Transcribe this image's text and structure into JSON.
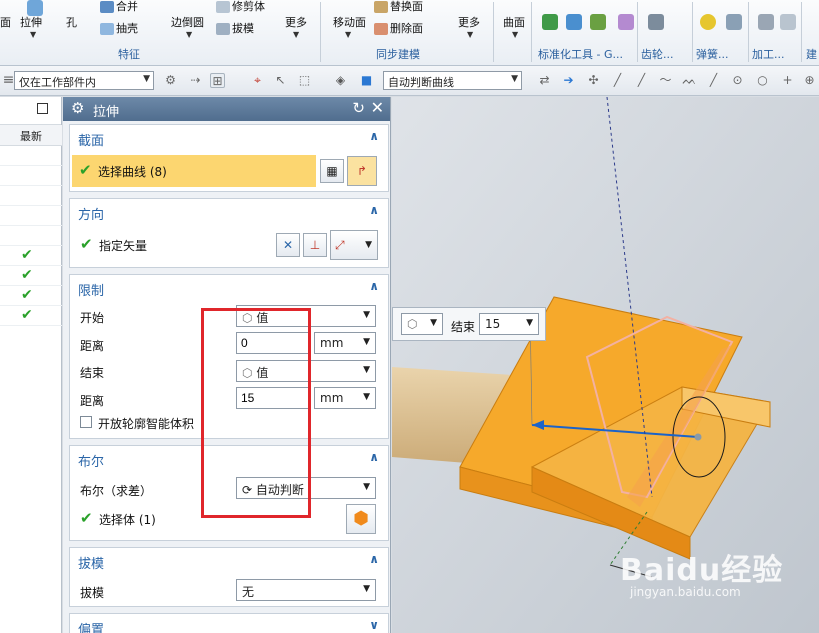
{
  "ribbon": {
    "cmds": {
      "mian": "面",
      "lashen": "拉伸",
      "kong": "孔",
      "hebing": "合并",
      "chouke": "抽壳",
      "biandaoyuan": "边倒圆",
      "xiujianti": "修剪体",
      "bamo": "拔模",
      "gengduo1": "更多",
      "yidongmian": "移动面",
      "tihuanmian": "替换面",
      "shanchumian": "删除面",
      "gengduo2": "更多",
      "qumian": "曲面"
    },
    "groups": {
      "tezheng": "特征",
      "tongbu": "同步建模",
      "biaozhun": "标准化工具 - G...",
      "chilun": "齿轮...",
      "tanhuang": "弹簧...",
      "jiagong": "加工...",
      "jian": "建"
    }
  },
  "selbar": {
    "scope": "仅在工作部件内",
    "curve_rule": "自动判断曲线"
  },
  "nav": {
    "col_header": "最新",
    "checked_rows": 4
  },
  "dialog": {
    "title": "拉伸",
    "section": {
      "title": "截面",
      "select_curve": "选择曲线 (8)"
    },
    "direction": {
      "title": "方向",
      "specify_vector": "指定矢量"
    },
    "limits": {
      "title": "限制",
      "start_label": "开始",
      "start_option": "值",
      "start_distance_label": "距离",
      "start_distance": "0",
      "start_unit": "mm",
      "end_label": "结束",
      "end_option": "值",
      "end_distance_label": "距离",
      "end_distance": "15",
      "end_unit": "mm",
      "open_profile": "开放轮廓智能体积"
    },
    "boolean": {
      "title": "布尔",
      "boolean_label": "布尔（求差）",
      "boolean_option": "自动判断",
      "select_body": "选择体 (1)"
    },
    "draft": {
      "title": "拔模",
      "draft_label": "拔模",
      "draft_option": "无"
    },
    "offset": {
      "title": "偏置"
    }
  },
  "viewport": {
    "end_label": "结束",
    "end_value": "15",
    "watermark": "Baidu经验",
    "watermark_url": "jingyan.baidu.com"
  },
  "colors": {
    "accent": "#2b66a8",
    "highlight": "#fcd670",
    "check": "#2aa12a",
    "annotation": "#e0262b",
    "solid": "#f6a92b"
  }
}
